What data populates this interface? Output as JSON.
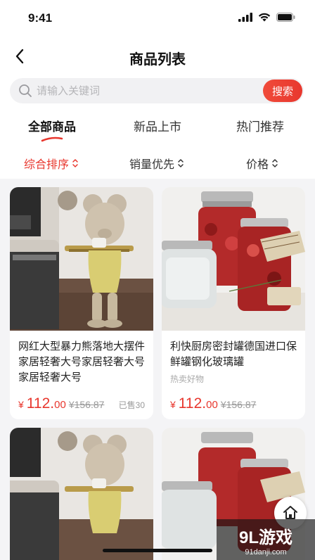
{
  "status": {
    "time": "9:41"
  },
  "nav": {
    "title": "商品列表"
  },
  "search": {
    "placeholder": "请输入关键词",
    "button": "搜索"
  },
  "tabs": [
    {
      "label": "全部商品",
      "active": true
    },
    {
      "label": "新品上市",
      "active": false
    },
    {
      "label": "热门推荐",
      "active": false
    }
  ],
  "sort": [
    {
      "label": "综合排序",
      "active": true
    },
    {
      "label": "销量优先",
      "active": false
    },
    {
      "label": "价格",
      "active": false
    }
  ],
  "products": [
    {
      "title": "网红大型暴力熊落地大摆件家居轻奢大号家居轻奢大号家居轻奢大号",
      "tag": "",
      "currency": "¥",
      "price": "112.",
      "cents": "00",
      "orig_price": "¥156.87",
      "sold": "已售30",
      "image": "bear-statue"
    },
    {
      "title": "利快厨房密封罐德国进口保鲜罐钢化玻璃罐",
      "tag": "热卖好物",
      "currency": "¥",
      "price": "112.",
      "cents": "00",
      "orig_price": "¥156.87",
      "sold": "",
      "image": "glass-jars"
    },
    {
      "image": "bear-statue"
    },
    {
      "image": "glass-jars"
    }
  ],
  "watermark": {
    "logo": "9L游戏",
    "url": "91danji.com"
  },
  "colors": {
    "accent": "#e8372e",
    "background": "#f4f4f6"
  }
}
